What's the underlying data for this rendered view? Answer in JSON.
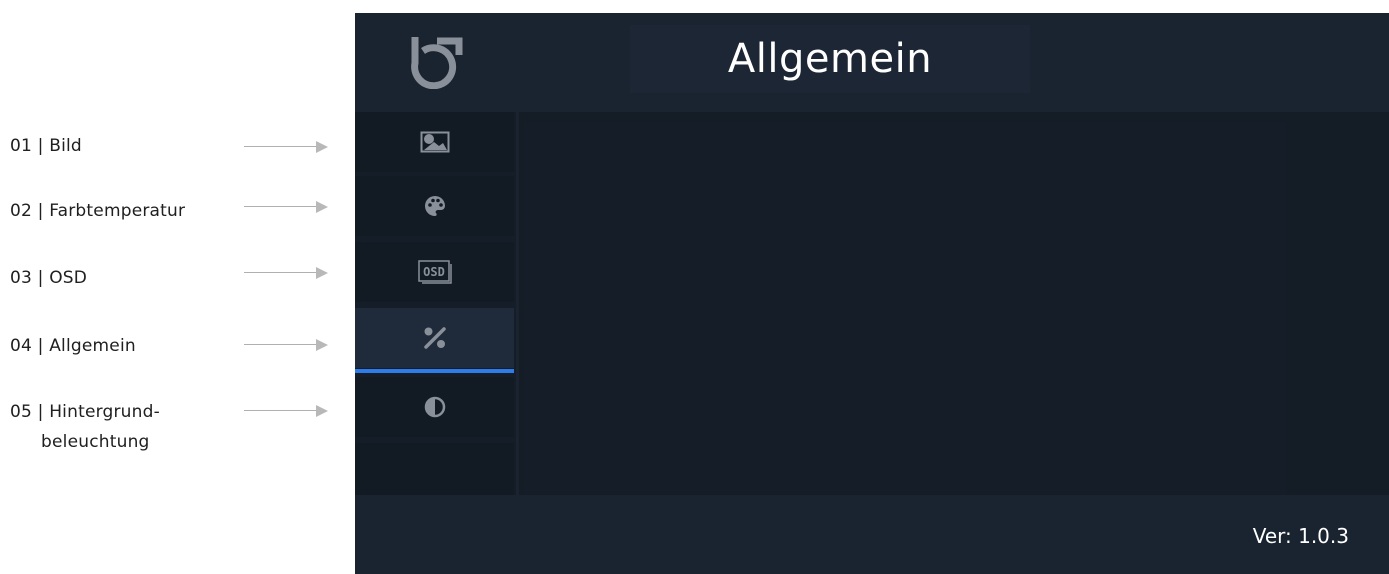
{
  "annotations": [
    {
      "number": "01",
      "separator": "|",
      "label": "Bild",
      "label_cont": ""
    },
    {
      "number": "02",
      "separator": "|",
      "label": "Farbtemperatur",
      "label_cont": ""
    },
    {
      "number": "03",
      "separator": "|",
      "label": "OSD",
      "label_cont": ""
    },
    {
      "number": "04",
      "separator": "|",
      "label": "Allgemein",
      "label_cont": ""
    },
    {
      "number": "05",
      "separator": "|",
      "label": "Hintergrund-",
      "label_cont": "beleuchtung"
    }
  ],
  "header": {
    "title": "Allgemein",
    "logo_icon": "brand-logo-icon"
  },
  "menu": {
    "items": [
      {
        "icon": "picture-icon",
        "active": false
      },
      {
        "icon": "palette-icon",
        "active": false
      },
      {
        "icon": "osd-icon",
        "active": false,
        "icon_text": "OSD"
      },
      {
        "icon": "tools-icon",
        "active": true
      },
      {
        "icon": "contrast-icon",
        "active": false
      }
    ]
  },
  "footer": {
    "version": "Ver: 1.0.3"
  },
  "colors": {
    "screen_bg": "#1a2430",
    "accent": "#2e7bea",
    "icon": "#8a9099"
  }
}
